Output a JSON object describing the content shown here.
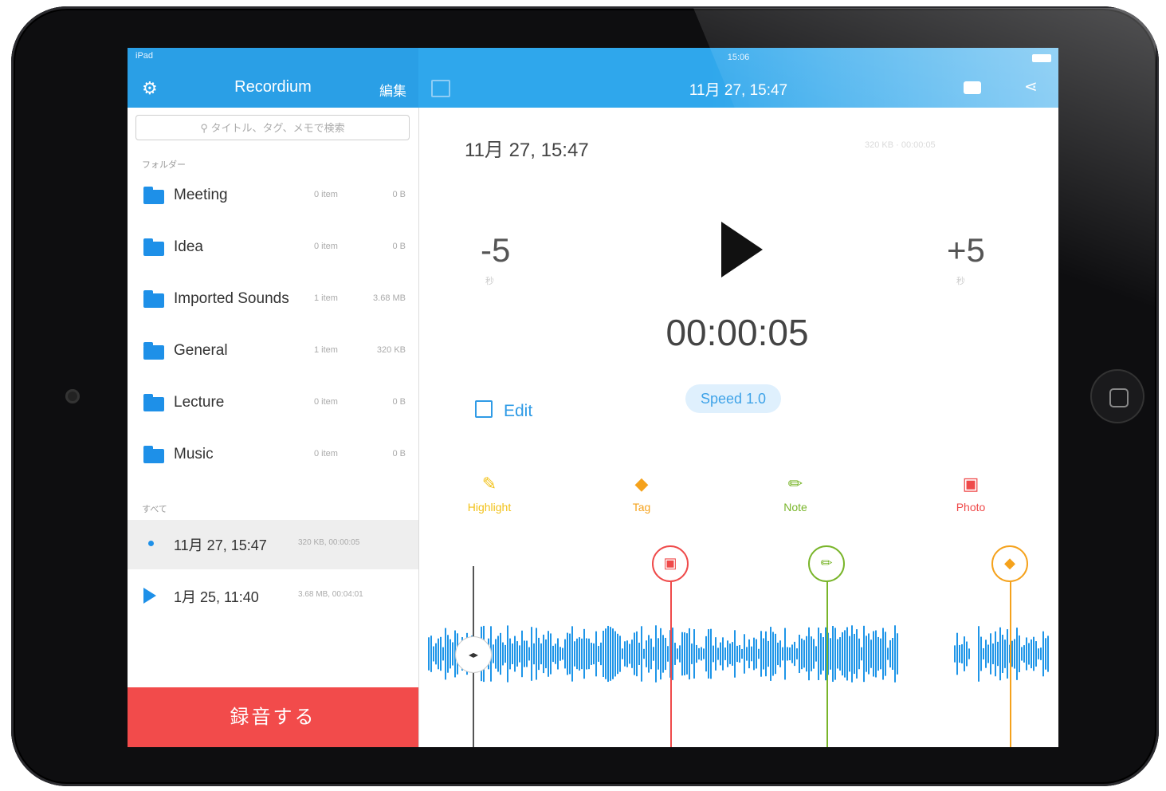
{
  "left": {
    "status": "iPad",
    "app_title": "Recordium",
    "edit_label": "編集",
    "search_placeholder": "タイトル、タグ、メモで検索",
    "folders_label": "フォルダー",
    "folders": [
      {
        "name": "Meeting",
        "count": "0 item",
        "size": "0 B"
      },
      {
        "name": "Idea",
        "count": "0 item",
        "size": "0 B"
      },
      {
        "name": "Imported Sounds",
        "count": "1 item",
        "size": "3.68 MB"
      },
      {
        "name": "General",
        "count": "1 item",
        "size": "320 KB"
      },
      {
        "name": "Lecture",
        "count": "0 item",
        "size": "0 B"
      },
      {
        "name": "Music",
        "count": "0 item",
        "size": "0 B"
      }
    ],
    "recordings_label": "すべて",
    "recordings": [
      {
        "name": "11月 27, 15:47",
        "meta": "320 KB, 00:00:05"
      },
      {
        "name": "1月 25, 11:40",
        "meta": "3.68 MB, 00:04:01"
      }
    ],
    "record_button": "録音する"
  },
  "right": {
    "status_time": "15:06",
    "title": "11月 27, 15:47",
    "date": "11月 27, 15:47",
    "meta": "320 KB · 00:00:05",
    "skip_back": "-5",
    "skip_back_sub": "秒",
    "skip_fwd": "+5",
    "skip_fwd_sub": "秒",
    "timer": "00:00:05",
    "edit_label": "Edit",
    "speed_label": "Speed 1.0",
    "actions": {
      "highlight": "Highlight",
      "tag": "Tag",
      "note": "Note",
      "photo": "Photo"
    }
  },
  "colors": {
    "header_blue": "#2a9fe6",
    "record_red": "#f24b4b",
    "wave_blue": "#1e95e8",
    "photo_red": "#ef4a4a",
    "note_green": "#79b52a",
    "tag_orange": "#f5a21c",
    "highlight_yellow": "#f2c21a"
  }
}
